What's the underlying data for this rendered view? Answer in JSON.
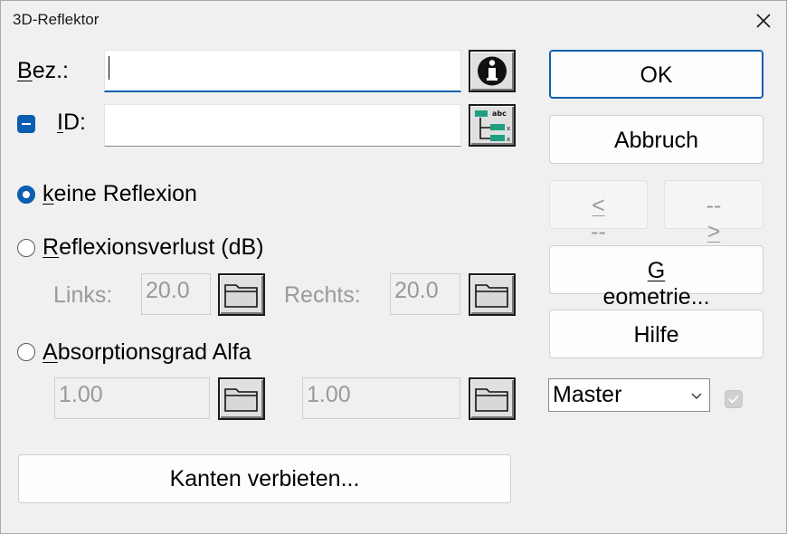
{
  "window": {
    "title": "3D-Reflektor"
  },
  "labels": {
    "bez_prefix": "B",
    "bez_rest": "ez.:",
    "id_prefix": "I",
    "id_rest": "D:"
  },
  "fields": {
    "bez_value": "",
    "id_value": ""
  },
  "options": {
    "keine_prefix": "k",
    "keine_rest": "eine Reflexion",
    "reflexionsverlust_prefix": "R",
    "reflexionsverlust_rest": "eflexionsverlust (dB)",
    "absorptionsgrad_prefix": "A",
    "absorptionsgrad_rest": "bsorptionsgrad Alfa",
    "selected": "keine Reflexion"
  },
  "reflexion": {
    "links_label": "Links:",
    "links_value": "20.0",
    "rechts_label": "Rechts:",
    "rechts_value": "20.0"
  },
  "absorption": {
    "value1": "1.00",
    "value2": "1.00"
  },
  "buttons": {
    "ok": "OK",
    "abbruch": "Abbruch",
    "prev_prefix": "<",
    "prev_rest": "--",
    "next_prefix": "--",
    "next_suffix": ">",
    "geometrie_prefix": "G",
    "geometrie_rest": "eometrie...",
    "hilfe": "Hilfe",
    "kanten": "Kanten verbieten..."
  },
  "dropdown": {
    "selected": "Master"
  },
  "icons": {
    "info": "info-icon",
    "id_tree": "id-tree-icon",
    "folder": "folder-icon",
    "close": "close-icon",
    "chevron": "chevron-down-icon"
  },
  "colors": {
    "accent": "#0a5fb0",
    "disabled_text": "#9a9a9a",
    "window_bg": "#f0f0f0"
  }
}
